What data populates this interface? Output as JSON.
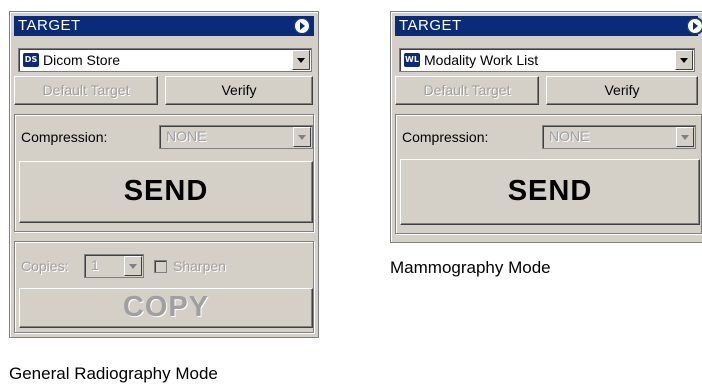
{
  "panels": {
    "general": {
      "title": "TARGET",
      "target_badge": "DS",
      "target_value": "Dicom Store",
      "default_target_label": "Default Target",
      "verify_label": "Verify",
      "compression_label": "Compression:",
      "compression_value": "NONE",
      "send_label": "SEND",
      "copies_label": "Copies:",
      "copies_value": "1",
      "sharpen_label": "Sharpen",
      "copy_label": "COPY",
      "caption": "General Radiography Mode"
    },
    "mammo": {
      "title": "TARGET",
      "target_badge": "WL",
      "target_value": "Modality Work List",
      "default_target_label": "Default Target",
      "verify_label": "Verify",
      "compression_label": "Compression:",
      "compression_value": "NONE",
      "send_label": "SEND",
      "caption": "Mammography Mode"
    }
  },
  "icons": {
    "title_icon": "play-circle-icon",
    "dropdown_icon": "chevron-down-icon"
  },
  "colors": {
    "titlebar": "#0a2a7a",
    "panel_bg": "#d4d0c8",
    "disabled_text": "#a0a0a0"
  }
}
